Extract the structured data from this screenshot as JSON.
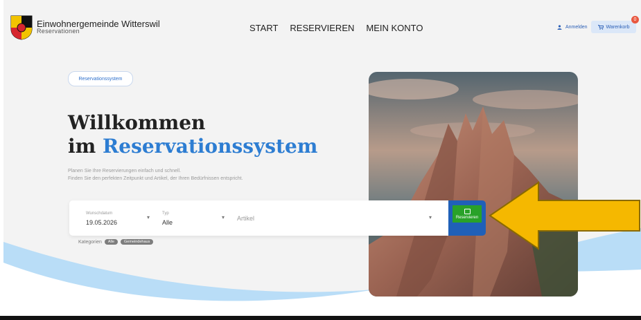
{
  "brand": {
    "title": "Einwohnergemeinde Witterswil",
    "subtitle": "Reservationen",
    "logo_colors": [
      "#f2c300",
      "#d6262f",
      "#111111",
      "#ffffff"
    ]
  },
  "nav": {
    "items": [
      "START",
      "RESERVIEREN",
      "MEIN KONTO"
    ]
  },
  "account": {
    "login_label": "Anmelden",
    "cart_label": "Warenkorb",
    "cart_count": "0"
  },
  "hero": {
    "badge": "Reservationssystem",
    "title_line1": "Willkommen",
    "title_line2_prefix": "im ",
    "title_line2_accent": "Reservationssystem",
    "desc_line1": "Planen Sie Ihre Reservierungen einfach und schnell.",
    "desc_line2": "Finden Sie den perfekten Zeitpunkt und Artikel, der Ihren Bedürfnissen entspricht."
  },
  "search": {
    "date_label": "Wunschdatum",
    "date_value": "19.05.2026",
    "type_label": "Typ",
    "type_value": "Alle",
    "article_placeholder": "Artikel",
    "button_label": "Reservieren"
  },
  "categories": {
    "label": "Kategorien",
    "chips": [
      "Alle",
      "Gemeindehaus"
    ]
  },
  "colors": {
    "accent": "#2d7dd2",
    "button": "#2060b8",
    "button_inner": "#29a229",
    "arrow": "#f5b800",
    "wave": "#b9ddf7"
  }
}
